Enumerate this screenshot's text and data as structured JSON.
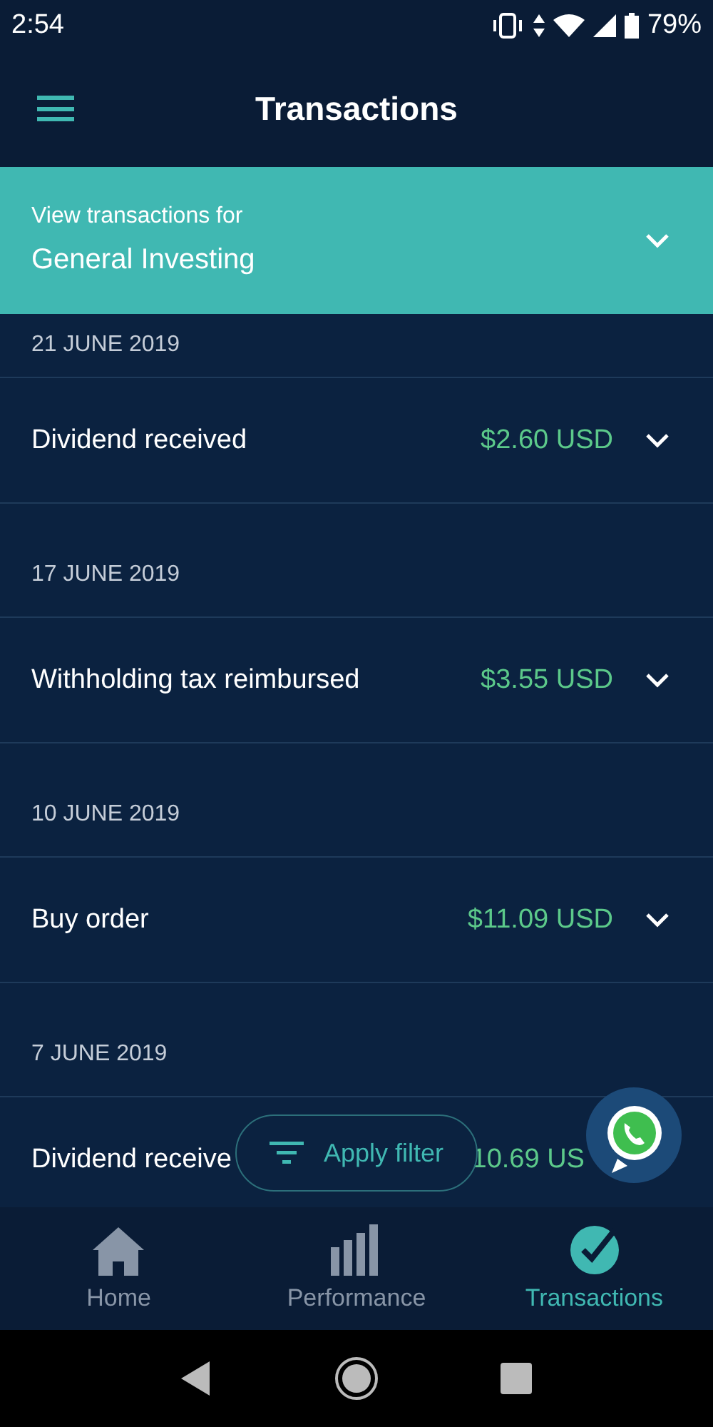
{
  "status_bar": {
    "time": "2:54",
    "battery": "79%"
  },
  "header": {
    "title": "Transactions"
  },
  "account_selector": {
    "label": "View transactions for",
    "value": "General Investing"
  },
  "groups": [
    {
      "date": "21 JUNE 2019",
      "transactions": [
        {
          "description": "Dividend received",
          "amount": "$2.60 USD",
          "expanded": false
        }
      ]
    },
    {
      "date": "17 JUNE 2019",
      "transactions": [
        {
          "description": "Withholding tax reimbursed",
          "amount": "$3.55 USD",
          "expanded": false
        }
      ]
    },
    {
      "date": "10 JUNE 2019",
      "transactions": [
        {
          "description": "Buy order",
          "amount": "$11.09 USD",
          "expanded": false
        }
      ]
    },
    {
      "date": "7 JUNE 2019",
      "transactions": [
        {
          "description": "Dividend receive",
          "amount": "10.69 US"
        }
      ]
    }
  ],
  "filter_button": {
    "label": "Apply filter"
  },
  "bottom_nav": [
    {
      "kind": "home",
      "label": "Home",
      "selected": false
    },
    {
      "kind": "performance",
      "label": "Performance",
      "selected": false
    },
    {
      "kind": "transactions",
      "label": "Transactions",
      "selected": true
    }
  ]
}
